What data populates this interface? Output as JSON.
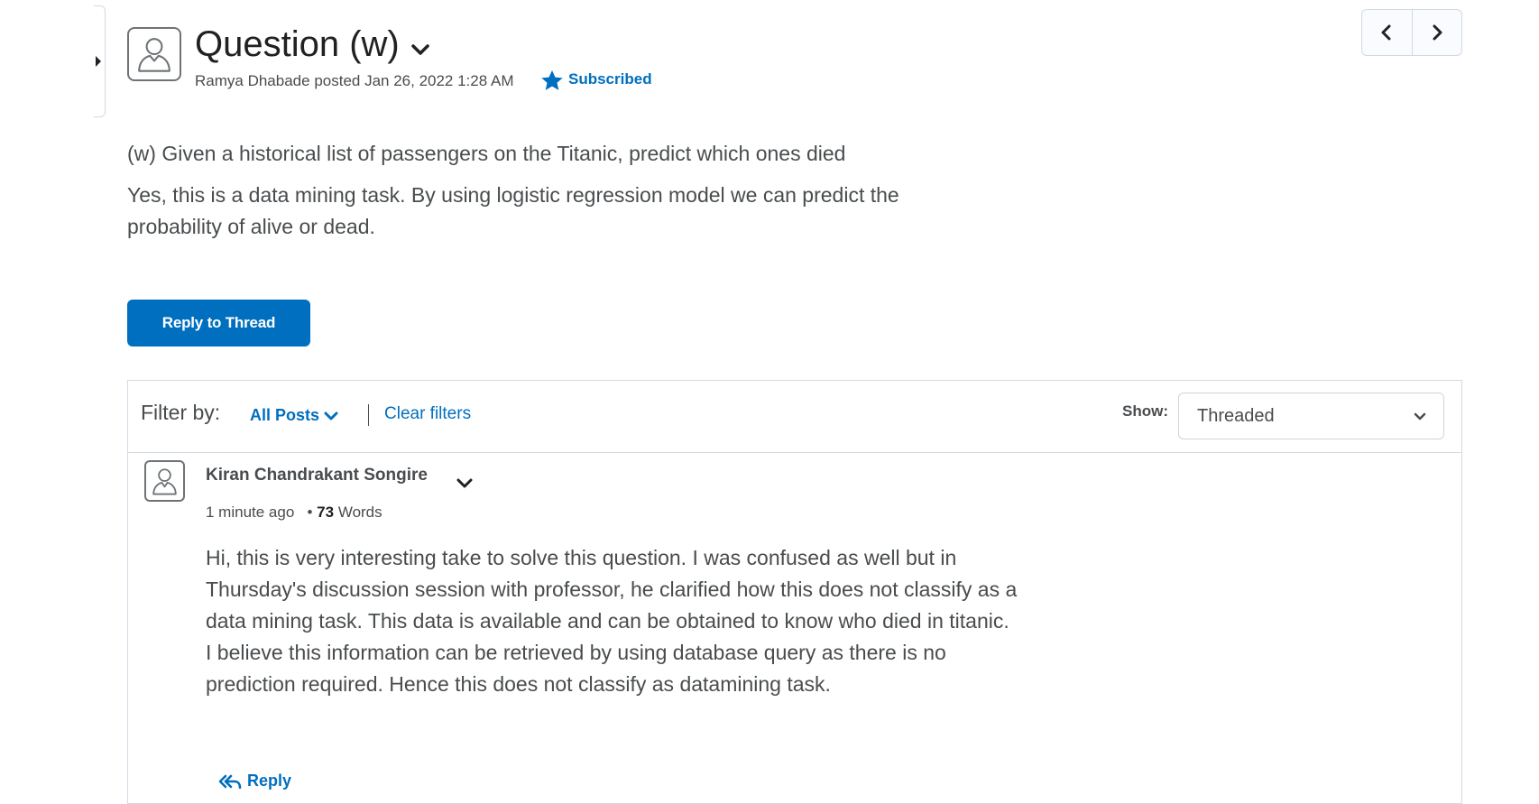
{
  "topic": {
    "title": "Question (w)",
    "author": "Ramya Dhabade",
    "posted_text": "posted Jan 26, 2022 1:28 AM",
    "subscribed_label": "Subscribed",
    "paragraph_1": "(w) Given a historical list of passengers on the Titanic, predict which ones died",
    "paragraph_2": "Yes, this is a data mining task. By using logistic regression model we can predict the probability of alive or dead.",
    "reply_button_label": "Reply to Thread"
  },
  "filters": {
    "filter_by_label": "Filter by:",
    "all_posts_label": "All Posts",
    "clear_filters_label": "Clear filters",
    "show_label": "Show:",
    "show_value": "Threaded"
  },
  "reply": {
    "author": "Kiran Chandrakant Songire",
    "time": "1 minute ago",
    "word_count": "73",
    "words_label": "Words",
    "body": "Hi, this is very interesting take to solve this question. I was confused as well but in Thursday's discussion session with professor, he clarified how this does not classify as a data mining task. This data is available and can be obtained to know who died in titanic. I believe this information can be retrieved by using database query as there is no prediction required. Hence this does not classify as datamining task.",
    "reply_label": "Reply"
  },
  "colors": {
    "accent": "#006fbf",
    "text": "#494c4e",
    "border": "#d3d9e3"
  },
  "icons": {
    "side_toggle": "caret-right-icon",
    "user": "user-avatar-icon",
    "title_menu": "chevron-down-icon",
    "subscribed": "star-icon",
    "prev": "chevron-left-icon",
    "next": "chevron-right-icon",
    "reply": "reply-all-icon"
  }
}
